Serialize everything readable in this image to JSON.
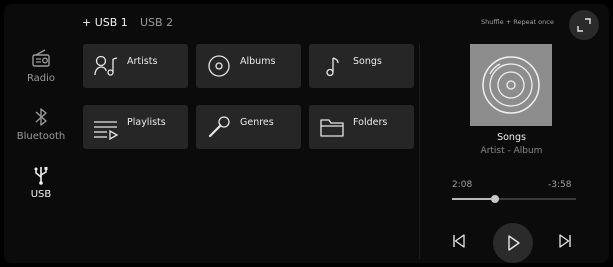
{
  "sources": [
    {
      "label": "Radio",
      "icon": "radio-icon",
      "active": false
    },
    {
      "label": "Bluetooth",
      "icon": "bluetooth-icon",
      "active": false
    },
    {
      "label": "USB",
      "icon": "usb-icon",
      "active": true
    }
  ],
  "tabs": [
    {
      "label": "+ USB 1",
      "active": true
    },
    {
      "label": "USB 2",
      "active": false
    }
  ],
  "playback_mode": "Shuffle + Repeat once",
  "categories": [
    {
      "label": "Artists",
      "icon": "artist-icon"
    },
    {
      "label": "Albums",
      "icon": "album-icon"
    },
    {
      "label": "Songs",
      "icon": "music-note-icon"
    },
    {
      "label": "Playlists",
      "icon": "playlist-icon"
    },
    {
      "label": "Genres",
      "icon": "microphone-icon"
    },
    {
      "label": "Folders",
      "icon": "folder-icon"
    }
  ],
  "now_playing": {
    "title": "Songs",
    "subtitle": "Artist - Album",
    "elapsed": "2:08",
    "remaining": "-3:58",
    "progress": 0.35
  },
  "colors": {
    "background": "#0b0b0b",
    "tile": "#262626",
    "artwork": "#8d8d8d"
  }
}
